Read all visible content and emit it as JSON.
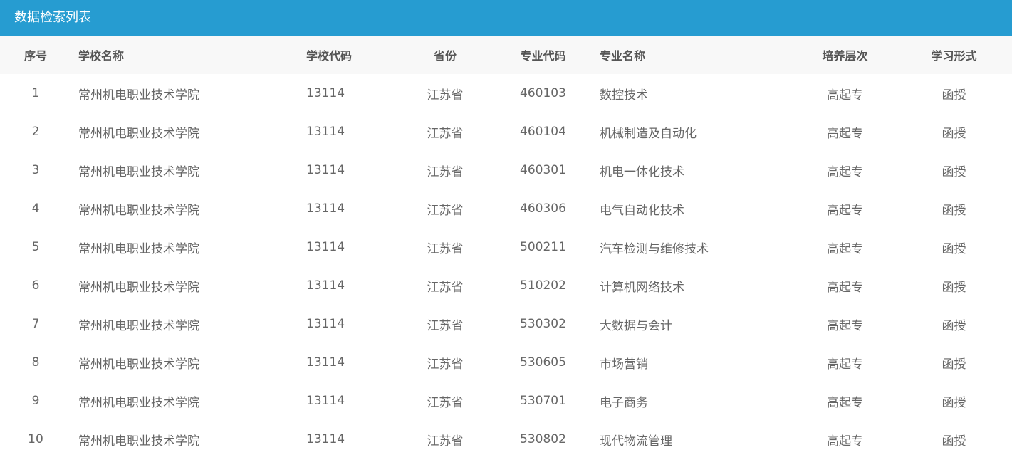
{
  "panel": {
    "title": "数据检索列表"
  },
  "columns": [
    "序号",
    "学校名称",
    "学校代码",
    "省份",
    "专业代码",
    "专业名称",
    "培养层次",
    "学习形式"
  ],
  "rows": [
    [
      "1",
      "常州机电职业技术学院",
      "13114",
      "江苏省",
      "460103",
      "数控技术",
      "高起专",
      "函授"
    ],
    [
      "2",
      "常州机电职业技术学院",
      "13114",
      "江苏省",
      "460104",
      "机械制造及自动化",
      "高起专",
      "函授"
    ],
    [
      "3",
      "常州机电职业技术学院",
      "13114",
      "江苏省",
      "460301",
      "机电一体化技术",
      "高起专",
      "函授"
    ],
    [
      "4",
      "常州机电职业技术学院",
      "13114",
      "江苏省",
      "460306",
      "电气自动化技术",
      "高起专",
      "函授"
    ],
    [
      "5",
      "常州机电职业技术学院",
      "13114",
      "江苏省",
      "500211",
      "汽车检测与维修技术",
      "高起专",
      "函授"
    ],
    [
      "6",
      "常州机电职业技术学院",
      "13114",
      "江苏省",
      "510202",
      "计算机网络技术",
      "高起专",
      "函授"
    ],
    [
      "7",
      "常州机电职业技术学院",
      "13114",
      "江苏省",
      "530302",
      "大数据与会计",
      "高起专",
      "函授"
    ],
    [
      "8",
      "常州机电职业技术学院",
      "13114",
      "江苏省",
      "530605",
      "市场营销",
      "高起专",
      "函授"
    ],
    [
      "9",
      "常州机电职业技术学院",
      "13114",
      "江苏省",
      "530701",
      "电子商务",
      "高起专",
      "函授"
    ],
    [
      "10",
      "常州机电职业技术学院",
      "13114",
      "江苏省",
      "530802",
      "现代物流管理",
      "高起专",
      "函授"
    ]
  ],
  "colors": {
    "header_bg": "#269cd1",
    "table_head_bg": "#f8f8f8"
  }
}
